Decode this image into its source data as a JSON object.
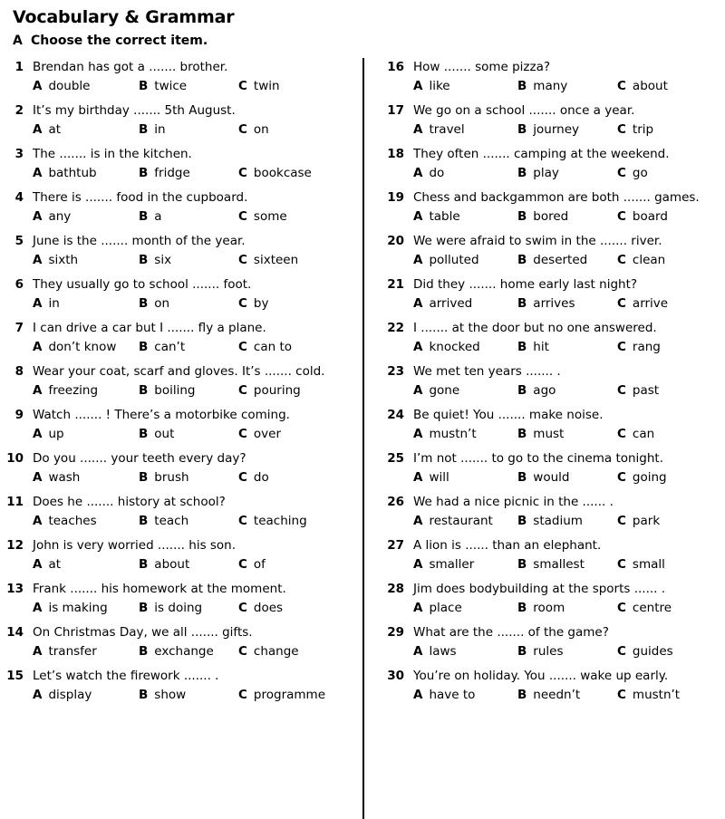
{
  "header": {
    "title": "Vocabulary & Grammar",
    "section_letter": "A",
    "section_instruction": "Choose the correct item."
  },
  "colors": {
    "text": "#000000",
    "background": "#ffffff",
    "divider": "#000000"
  },
  "left_column": [
    {
      "num": "1",
      "text": "Brendan has got a ....... brother.",
      "options": [
        {
          "letter": "A",
          "word": "double"
        },
        {
          "letter": "B",
          "word": "twice"
        },
        {
          "letter": "C",
          "word": "twin"
        }
      ]
    },
    {
      "num": "2",
      "text": "It’s my birthday ....... 5th August.",
      "options": [
        {
          "letter": "A",
          "word": "at"
        },
        {
          "letter": "B",
          "word": "in"
        },
        {
          "letter": "C",
          "word": "on"
        }
      ]
    },
    {
      "num": "3",
      "text": "The ....... is in the kitchen.",
      "options": [
        {
          "letter": "A",
          "word": "bathtub"
        },
        {
          "letter": "B",
          "word": "fridge"
        },
        {
          "letter": "C",
          "word": "bookcase"
        }
      ]
    },
    {
      "num": "4",
      "text": "There is ....... food in the cupboard.",
      "options": [
        {
          "letter": "A",
          "word": "any"
        },
        {
          "letter": "B",
          "word": "a"
        },
        {
          "letter": "C",
          "word": "some"
        }
      ]
    },
    {
      "num": "5",
      "text": "June is the ....... month of the year.",
      "options": [
        {
          "letter": "A",
          "word": "sixth"
        },
        {
          "letter": "B",
          "word": "six"
        },
        {
          "letter": "C",
          "word": "sixteen"
        }
      ]
    },
    {
      "num": "6",
      "text": "They usually go to school ....... foot.",
      "options": [
        {
          "letter": "A",
          "word": "in"
        },
        {
          "letter": "B",
          "word": "on"
        },
        {
          "letter": "C",
          "word": "by"
        }
      ]
    },
    {
      "num": "7",
      "text": "I can drive a car but I ....... fly a plane.",
      "options": [
        {
          "letter": "A",
          "word": "don’t know"
        },
        {
          "letter": "B",
          "word": "can’t"
        },
        {
          "letter": "C",
          "word": "can to"
        }
      ]
    },
    {
      "num": "8",
      "text": "Wear your coat, scarf and gloves. It’s ....... cold.",
      "options": [
        {
          "letter": "A",
          "word": "freezing"
        },
        {
          "letter": "B",
          "word": "boiling"
        },
        {
          "letter": "C",
          "word": "pouring"
        }
      ]
    },
    {
      "num": "9",
      "text": "Watch ....... ! There’s a motorbike coming.",
      "options": [
        {
          "letter": "A",
          "word": "up"
        },
        {
          "letter": "B",
          "word": "out"
        },
        {
          "letter": "C",
          "word": "over"
        }
      ]
    },
    {
      "num": "10",
      "text": "Do you ....... your teeth every day?",
      "options": [
        {
          "letter": "A",
          "word": "wash"
        },
        {
          "letter": "B",
          "word": "brush"
        },
        {
          "letter": "C",
          "word": "do"
        }
      ]
    },
    {
      "num": "11",
      "text": "Does he ....... history at school?",
      "options": [
        {
          "letter": "A",
          "word": "teaches"
        },
        {
          "letter": "B",
          "word": "teach"
        },
        {
          "letter": "C",
          "word": "teaching"
        }
      ]
    },
    {
      "num": "12",
      "text": "John is very worried ....... his son.",
      "options": [
        {
          "letter": "A",
          "word": "at"
        },
        {
          "letter": "B",
          "word": "about"
        },
        {
          "letter": "C",
          "word": "of"
        }
      ]
    },
    {
      "num": "13",
      "text": "Frank ....... his homework at the moment.",
      "options": [
        {
          "letter": "A",
          "word": "is making"
        },
        {
          "letter": "B",
          "word": "is doing"
        },
        {
          "letter": "C",
          "word": "does"
        }
      ]
    },
    {
      "num": "14",
      "text": "On Christmas Day, we all ....... gifts.",
      "options": [
        {
          "letter": "A",
          "word": "transfer"
        },
        {
          "letter": "B",
          "word": "exchange"
        },
        {
          "letter": "C",
          "word": "change"
        }
      ]
    },
    {
      "num": "15",
      "text": "Let’s watch the firework ....... .",
      "options": [
        {
          "letter": "A",
          "word": "display"
        },
        {
          "letter": "B",
          "word": "show"
        },
        {
          "letter": "C",
          "word": "programme"
        }
      ]
    }
  ],
  "right_column": [
    {
      "num": "16",
      "text": "How ....... some pizza?",
      "options": [
        {
          "letter": "A",
          "word": "like"
        },
        {
          "letter": "B",
          "word": "many"
        },
        {
          "letter": "C",
          "word": "about"
        }
      ]
    },
    {
      "num": "17",
      "text": "We go on a school ....... once a year.",
      "options": [
        {
          "letter": "A",
          "word": "travel"
        },
        {
          "letter": "B",
          "word": "journey"
        },
        {
          "letter": "C",
          "word": "trip"
        }
      ]
    },
    {
      "num": "18",
      "text": "They often ....... camping at the weekend.",
      "options": [
        {
          "letter": "A",
          "word": "do"
        },
        {
          "letter": "B",
          "word": "play"
        },
        {
          "letter": "C",
          "word": "go"
        }
      ]
    },
    {
      "num": "19",
      "text": "Chess and backgammon are both ....... games.",
      "options": [
        {
          "letter": "A",
          "word": "table"
        },
        {
          "letter": "B",
          "word": "bored"
        },
        {
          "letter": "C",
          "word": "board"
        }
      ]
    },
    {
      "num": "20",
      "text": "We were afraid to swim in the ....... river.",
      "options": [
        {
          "letter": "A",
          "word": "polluted"
        },
        {
          "letter": "B",
          "word": "deserted"
        },
        {
          "letter": "C",
          "word": "clean"
        }
      ]
    },
    {
      "num": "21",
      "text": "Did they ....... home early last night?",
      "options": [
        {
          "letter": "A",
          "word": "arrived"
        },
        {
          "letter": "B",
          "word": "arrives"
        },
        {
          "letter": "C",
          "word": "arrive"
        }
      ]
    },
    {
      "num": "22",
      "text": "I ....... at the door but no one answered.",
      "options": [
        {
          "letter": "A",
          "word": "knocked"
        },
        {
          "letter": "B",
          "word": "hit"
        },
        {
          "letter": "C",
          "word": "rang"
        }
      ]
    },
    {
      "num": "23",
      "text": "We met ten years ....... .",
      "options": [
        {
          "letter": "A",
          "word": "gone"
        },
        {
          "letter": "B",
          "word": "ago"
        },
        {
          "letter": "C",
          "word": "past"
        }
      ]
    },
    {
      "num": "24",
      "text": "Be quiet! You ....... make noise.",
      "options": [
        {
          "letter": "A",
          "word": "mustn’t"
        },
        {
          "letter": "B",
          "word": "must"
        },
        {
          "letter": "C",
          "word": "can"
        }
      ]
    },
    {
      "num": "25",
      "text": "I’m not ....... to go to the cinema tonight.",
      "options": [
        {
          "letter": "A",
          "word": "will"
        },
        {
          "letter": "B",
          "word": "would"
        },
        {
          "letter": "C",
          "word": "going"
        }
      ]
    },
    {
      "num": "26",
      "text": "We had a nice picnic in the ...... .",
      "options": [
        {
          "letter": "A",
          "word": "restaurant"
        },
        {
          "letter": "B",
          "word": "stadium"
        },
        {
          "letter": "C",
          "word": "park"
        }
      ]
    },
    {
      "num": "27",
      "text": "A lion is ...... than an elephant.",
      "options": [
        {
          "letter": "A",
          "word": "smaller"
        },
        {
          "letter": "B",
          "word": "smallest"
        },
        {
          "letter": "C",
          "word": "small"
        }
      ]
    },
    {
      "num": "28",
      "text": "Jim does bodybuilding at the sports ...... .",
      "options": [
        {
          "letter": "A",
          "word": "place"
        },
        {
          "letter": "B",
          "word": "room"
        },
        {
          "letter": "C",
          "word": "centre"
        }
      ]
    },
    {
      "num": "29",
      "text": "What are the ....... of the game?",
      "options": [
        {
          "letter": "A",
          "word": "laws"
        },
        {
          "letter": "B",
          "word": "rules"
        },
        {
          "letter": "C",
          "word": "guides"
        }
      ]
    },
    {
      "num": "30",
      "text": "You’re on holiday. You ....... wake up early.",
      "options": [
        {
          "letter": "A",
          "word": "have to"
        },
        {
          "letter": "B",
          "word": "needn’t"
        },
        {
          "letter": "C",
          "word": "mustn’t"
        }
      ]
    }
  ]
}
